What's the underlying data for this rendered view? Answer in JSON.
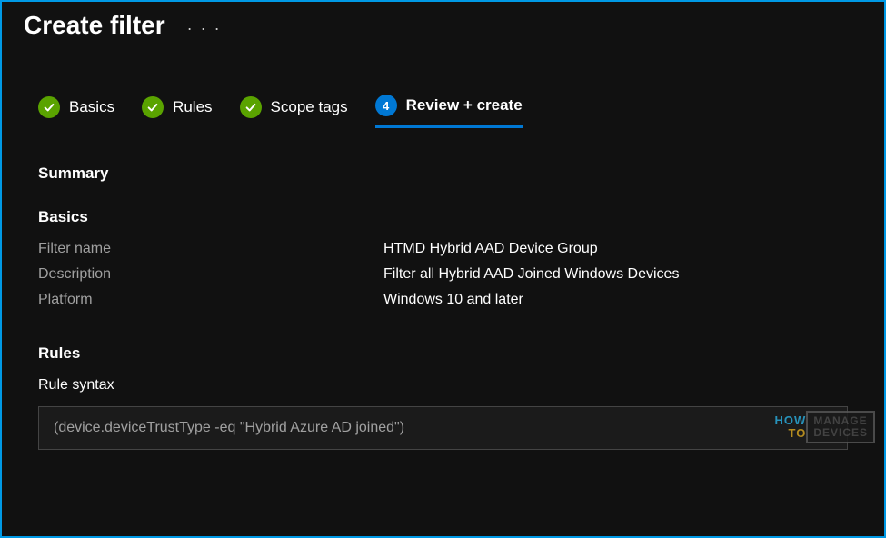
{
  "header": {
    "title": "Create filter"
  },
  "steps": [
    {
      "label": "Basics",
      "state": "complete"
    },
    {
      "label": "Rules",
      "state": "complete"
    },
    {
      "label": "Scope tags",
      "state": "complete"
    },
    {
      "label": "Review + create",
      "state": "current",
      "number": "4"
    }
  ],
  "summary": {
    "heading": "Summary"
  },
  "basics": {
    "heading": "Basics",
    "fields": {
      "filter_name_label": "Filter name",
      "filter_name_value": "HTMD Hybrid AAD Device Group",
      "description_label": "Description",
      "description_value": "Filter all Hybrid AAD Joined Windows Devices",
      "platform_label": "Platform",
      "platform_value": "Windows 10 and later"
    }
  },
  "rules": {
    "heading": "Rules",
    "syntax_label": "Rule syntax",
    "syntax_value": "(device.deviceTrustType -eq \"Hybrid Azure AD joined\")"
  },
  "watermark": {
    "line1": "HOW",
    "line2": "TO",
    "line3": "MANAGE",
    "line4": "DEVICES"
  }
}
